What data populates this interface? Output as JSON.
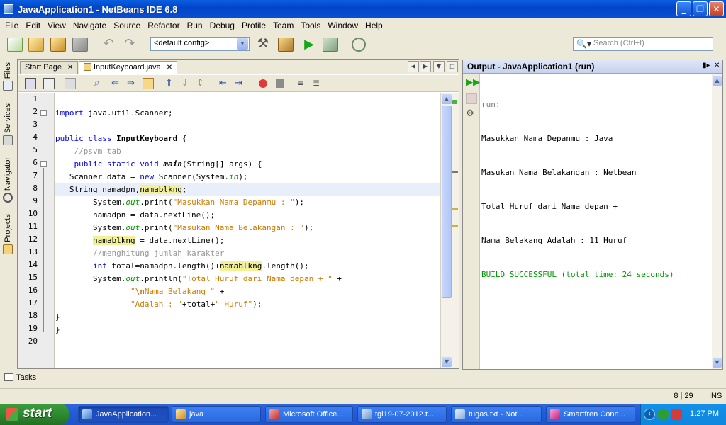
{
  "window": {
    "title": "JavaApplication1 - NetBeans IDE 6.8",
    "controls": [
      "minimize-icon",
      "restore-icon",
      "close-icon"
    ]
  },
  "menu": [
    "File",
    "Edit",
    "View",
    "Navigate",
    "Source",
    "Refactor",
    "Run",
    "Debug",
    "Profile",
    "Team",
    "Tools",
    "Window",
    "Help"
  ],
  "toolbar": {
    "config_value": "<default config>",
    "search_placeholder": "Search (Ctrl+I)"
  },
  "side_tabs": [
    "Files",
    "Services",
    "Navigator",
    "Projects"
  ],
  "editor": {
    "tabs": [
      {
        "label": "Start Page",
        "active": false
      },
      {
        "label": "InputKeyboard.java",
        "active": true
      }
    ],
    "line_numbers": [
      "1",
      "2",
      "3",
      "4",
      "5",
      "6",
      "7",
      "8",
      "9",
      "10",
      "11",
      "12",
      "13",
      "14",
      "15",
      "16",
      "17",
      "18",
      "19",
      "20"
    ],
    "code": {
      "l2_kw": "import",
      "l2_rest": " java.util.Scanner;",
      "l4_kw1": "public",
      "l4_kw2": "class",
      "l4_name": "InputKeyboard",
      "l4_rest": " {",
      "l5_comment": "//psvm tab",
      "l6_kw1": "public",
      "l6_kw2": "static",
      "l6_kw3": "void",
      "l6_name": "main",
      "l6_rest": "(String[] args) {",
      "l7_a": "Scanner data = ",
      "l7_kw": "new",
      "l7_b": " Scanner(System.",
      "l7_in": "in",
      "l7_c": ");",
      "l8_a": "String namadpn,",
      "l8_hl": "namablkng",
      "l8_b": ";",
      "l9_a": "System.",
      "l9_out": "out",
      "l9_b": ".print(",
      "l9_str": "\"Masukkan Nama Depanmu : \"",
      "l9_c": ");",
      "l10_a": "namadpn = data.nextLine();",
      "l11_a": "System.",
      "l11_out": "out",
      "l11_b": ".print(",
      "l11_str": "\"Masukan Nama Belakangan : \"",
      "l11_c": ");",
      "l12_hl": "namablkng",
      "l12_b": " = data.nextLine();",
      "l13_comment": "//menghitung jumlah karakter",
      "l14_kw": "int",
      "l14_a": " total=namadpn.length()+",
      "l14_hl": "namablkng",
      "l14_b": ".length();",
      "l15_a": "System.",
      "l15_out": "out",
      "l15_b": ".println(",
      "l15_str": "\"Total Huruf dari Nama depan + \"",
      "l15_c": " +",
      "l16_str1": "\"",
      "l16_esc": "\\n",
      "l16_str2": "Nama Belakang \"",
      "l16_c": " +",
      "l17_str": "\"Adalah : \"",
      "l17_a": "+total+",
      "l17_str2": "\" Huruf\"",
      "l17_c": ");",
      "l18": "}",
      "l19": "}"
    }
  },
  "output": {
    "title": "Output - JavaApplication1 (run)",
    "lines": [
      "run:",
      "Masukkan Nama Depanmu : Java",
      "Masukan Nama Belakangan : Netbean",
      "Total Huruf dari Nama depan +",
      "Nama Belakang Adalah : 11 Huruf",
      "BUILD SUCCESSFUL (total time: 24 seconds)"
    ]
  },
  "tasks_label": "Tasks",
  "status": {
    "position": "8 | 29",
    "mode": "INS"
  },
  "taskbar": {
    "start_label": "start",
    "items": [
      {
        "label": "JavaApplication...",
        "icon": "netbeans-icon",
        "active": true
      },
      {
        "label": "java",
        "icon": "folder-icon",
        "active": false
      },
      {
        "label": "Microsoft Office...",
        "icon": "office-icon",
        "active": false
      },
      {
        "label": "tgl19-07-2012.t...",
        "icon": "text-file-icon",
        "active": false
      },
      {
        "label": "tugas.txt - Not...",
        "icon": "notepad-icon",
        "active": false
      },
      {
        "label": "Smartfren Conn...",
        "icon": "smartfren-icon",
        "active": false
      }
    ],
    "clock": "1:27 PM"
  },
  "colors": {
    "keyword": "#0000e6",
    "string": "#ce7b00",
    "comment": "#969696",
    "success": "#009900",
    "title_bar": "#0a4ed3"
  }
}
